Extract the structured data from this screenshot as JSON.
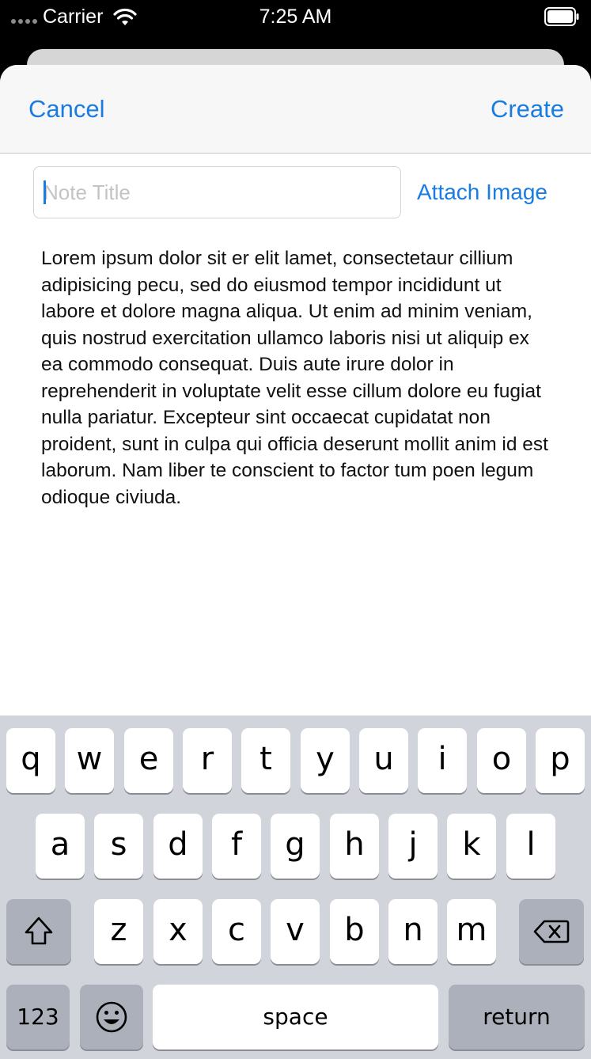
{
  "status_bar": {
    "carrier": "Carrier",
    "time": "7:25 AM"
  },
  "nav": {
    "cancel_label": "Cancel",
    "create_label": "Create"
  },
  "note": {
    "title_placeholder": "Note Title",
    "attach_label": "Attach Image",
    "body": "Lorem ipsum dolor sit er elit lamet, consectetaur cillium adipisicing pecu, sed do eiusmod tempor incididunt ut labore et dolore magna aliqua. Ut enim ad minim veniam, quis nostrud exercitation ullamco laboris nisi ut aliquip ex ea commodo consequat. Duis aute irure dolor in reprehenderit in voluptate velit esse cillum dolore eu fugiat nulla pariatur. Excepteur sint occaecat cupidatat non proident, sunt in culpa qui officia deserunt mollit anim id est laborum. Nam liber te conscient to factor tum poen legum odioque civiuda."
  },
  "keyboard": {
    "row1": [
      "q",
      "w",
      "e",
      "r",
      "t",
      "y",
      "u",
      "i",
      "o",
      "p"
    ],
    "row2": [
      "a",
      "s",
      "d",
      "f",
      "g",
      "h",
      "j",
      "k",
      "l"
    ],
    "row3": [
      "z",
      "x",
      "c",
      "v",
      "b",
      "n",
      "m"
    ],
    "numbers_label": "123",
    "space_label": "space",
    "return_label": "return",
    "shift_icon": "shift-icon",
    "delete_icon": "backspace-icon",
    "emoji_icon": "emoji-icon"
  },
  "colors": {
    "accent": "#1a7ce0",
    "keyboard_bg": "#d1d4da",
    "dark_key": "#abb0ba"
  }
}
